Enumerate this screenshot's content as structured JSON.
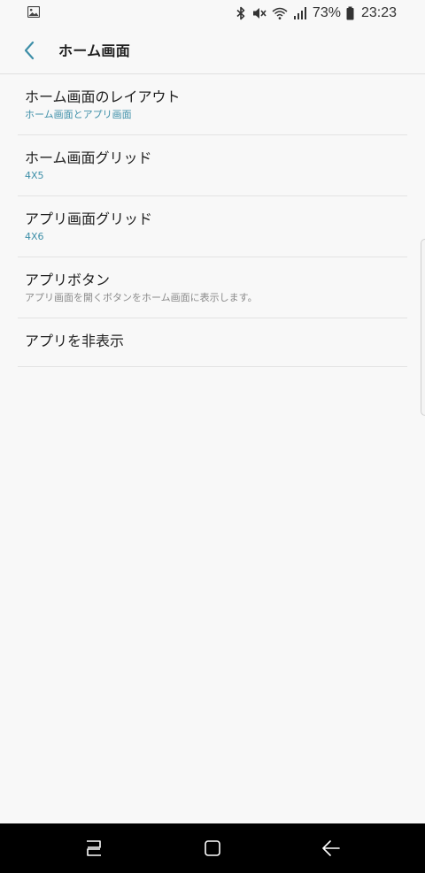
{
  "status_bar": {
    "battery_percent": "73%",
    "time": "23:23"
  },
  "app_bar": {
    "title": "ホーム画面"
  },
  "items": [
    {
      "title": "ホーム画面のレイアウト",
      "subtitle": "ホーム画面とアプリ画面"
    },
    {
      "title": "ホーム画面グリッド",
      "subtitle": "4X5"
    },
    {
      "title": "アプリ画面グリッド",
      "subtitle": "4X6"
    },
    {
      "title": "アプリボタン",
      "subtitle": "アプリ画面を開くボタンをホーム画面に表示します。"
    },
    {
      "title": "アプリを非表示"
    }
  ],
  "icons": {
    "status_left": "gallery-icon",
    "status_right": [
      "bluetooth-icon",
      "mute-icon",
      "wifi-icon",
      "signal-icon",
      "battery-icon"
    ],
    "app_bar": "back-arrow-icon",
    "nav": [
      "recents-icon",
      "home-icon",
      "back-icon"
    ]
  },
  "colors": {
    "accent": "#3e8fa8",
    "background": "#f8f8f8",
    "nav_bar": "#000000"
  }
}
